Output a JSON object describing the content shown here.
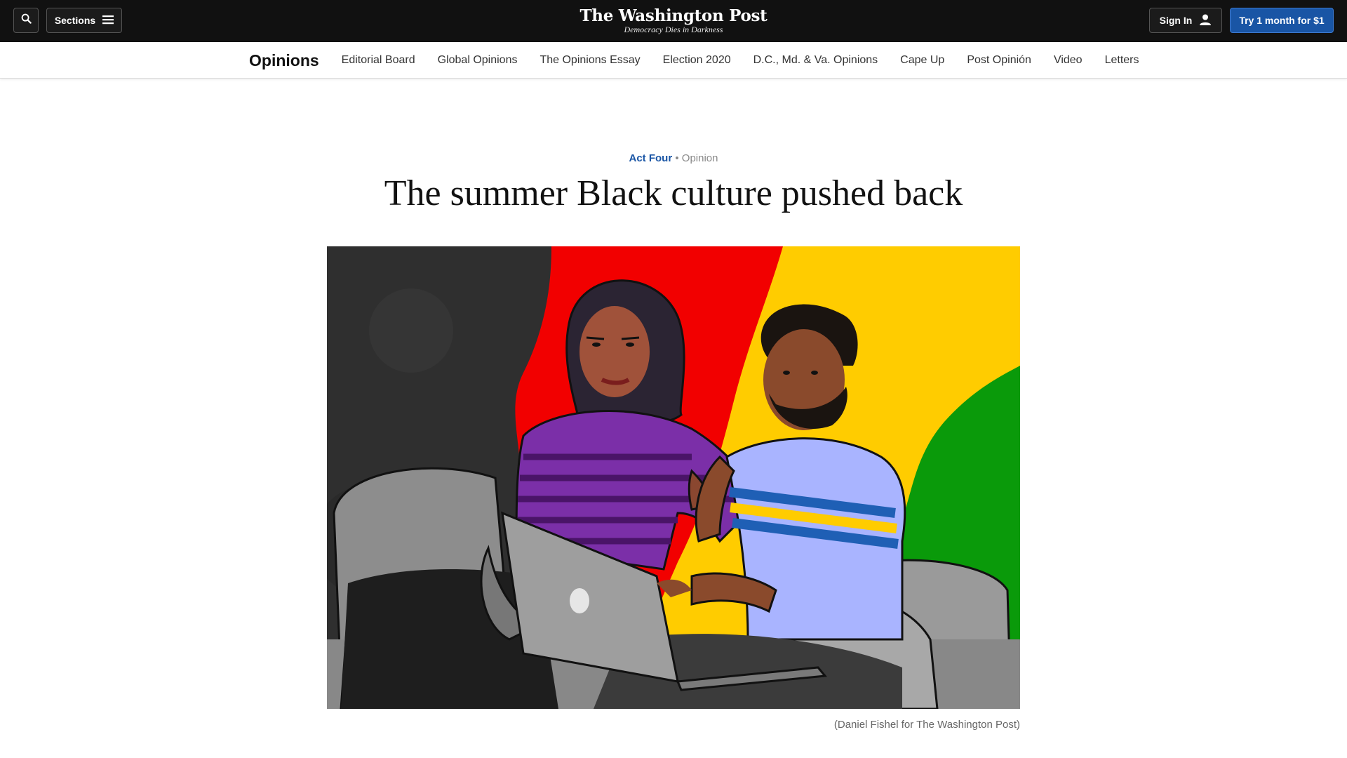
{
  "header": {
    "search_icon": "search-icon",
    "sections_label": "Sections",
    "sections_icon": "hamburger-icon",
    "logo_text": "The Washington Post",
    "tagline": "Democracy Dies in Darkness",
    "signin_label": "Sign In",
    "signin_icon": "user-icon",
    "subscribe_label": "Try 1 month for $1"
  },
  "subnav": {
    "title": "Opinions",
    "links": [
      "Editorial Board",
      "Global Opinions",
      "The Opinions Essay",
      "Election 2020",
      "D.C., Md. & Va. Opinions",
      "Cape Up",
      "Post Opinión",
      "Video",
      "Letters"
    ]
  },
  "article": {
    "kicker_section": "Act Four",
    "kicker_separator": "•",
    "kicker_label": "Opinion",
    "headline": "The summer Black culture pushed back",
    "caption": "(Daniel Fishel for The Washington Post)"
  },
  "colors": {
    "topbar": "#111111",
    "accent": "#1955a5",
    "illustration_red": "#f20000",
    "illustration_yellow": "#ffcc00",
    "illustration_green": "#0a9a0a"
  }
}
